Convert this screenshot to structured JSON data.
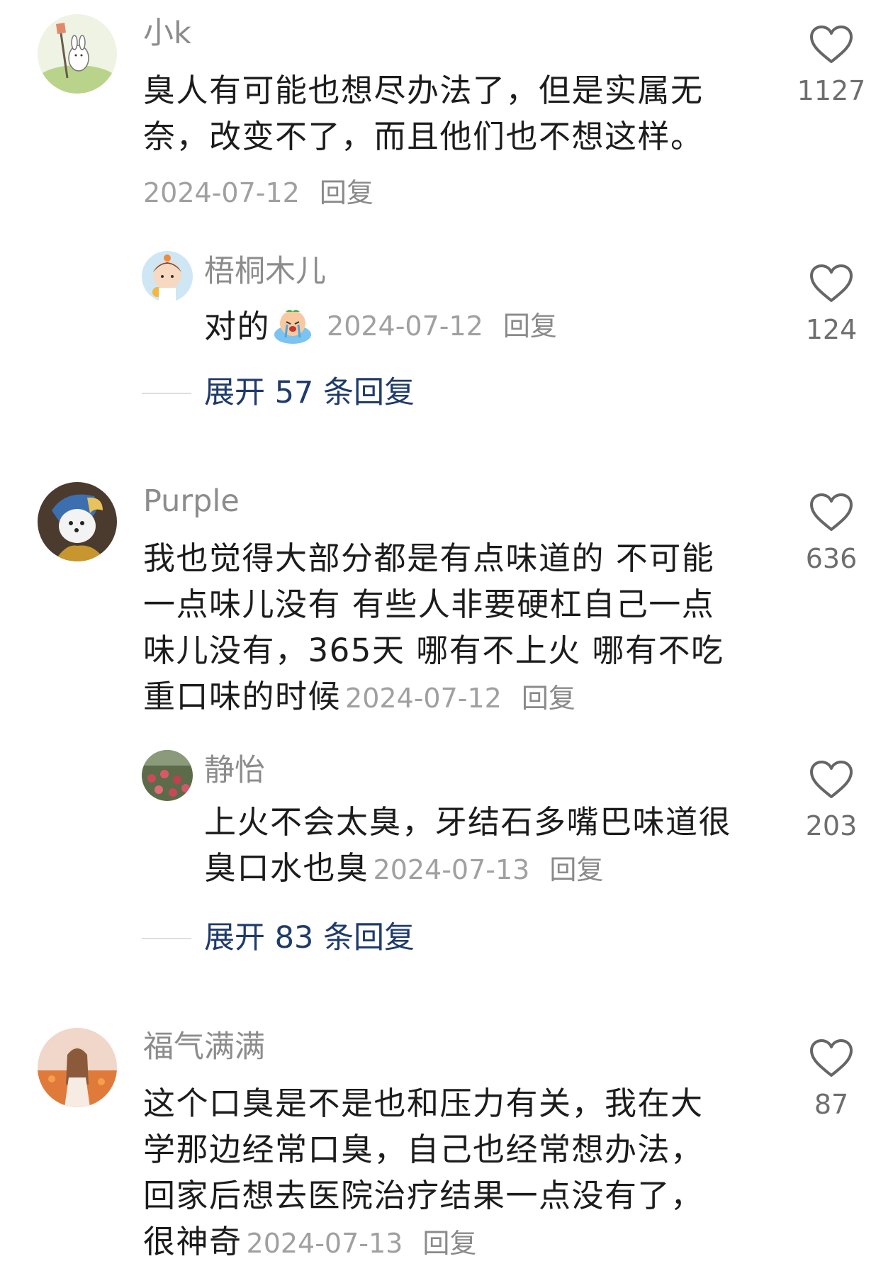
{
  "comments": [
    {
      "user": "小k",
      "text_lines": [
        "臭人有可能也想尽办法了，但是实属无",
        "奈，改变不了，而且他们也不想这样。"
      ],
      "date": "2024-07-12",
      "reply_label": "回复",
      "likes": "1127",
      "reply": {
        "user": "梧桐木儿",
        "text": "对的",
        "emoji": "crying-emoji",
        "date": "2024-07-12",
        "reply_label": "回复",
        "likes": "124"
      },
      "expand_label": "展开 57 条回复"
    },
    {
      "user": "Purple",
      "text_lines": [
        "我也觉得大部分都是有点味道的 不可能",
        "一点味儿没有 有些人非要硬杠自己一点",
        "味儿没有，365天 哪有不上火 哪有不吃"
      ],
      "text_last": "重口味的时候",
      "date": "2024-07-12",
      "reply_label": "回复",
      "likes": "636",
      "reply": {
        "user": "静怡",
        "text_lines": [
          "上火不会太臭，牙结石多嘴巴味道很"
        ],
        "text_last": "臭口水也臭",
        "date": "2024-07-13",
        "reply_label": "回复",
        "likes": "203"
      },
      "expand_label": "展开 83 条回复"
    },
    {
      "user": "福气满满",
      "text_lines": [
        "这个口臭是不是也和压力有关，我在大",
        "学那边经常口臭，自己也经常想办法，",
        "回家后想去医院治疗结果一点没有了，"
      ],
      "text_last": "很神奇",
      "date": "2024-07-13",
      "reply_label": "回复",
      "likes": "87"
    }
  ],
  "colors": {
    "name": "#8c8c8c",
    "text": "#1c1c1c",
    "meta": "#a0a0a0",
    "expand": "#1f3b6b",
    "heart_stroke": "#666666"
  }
}
